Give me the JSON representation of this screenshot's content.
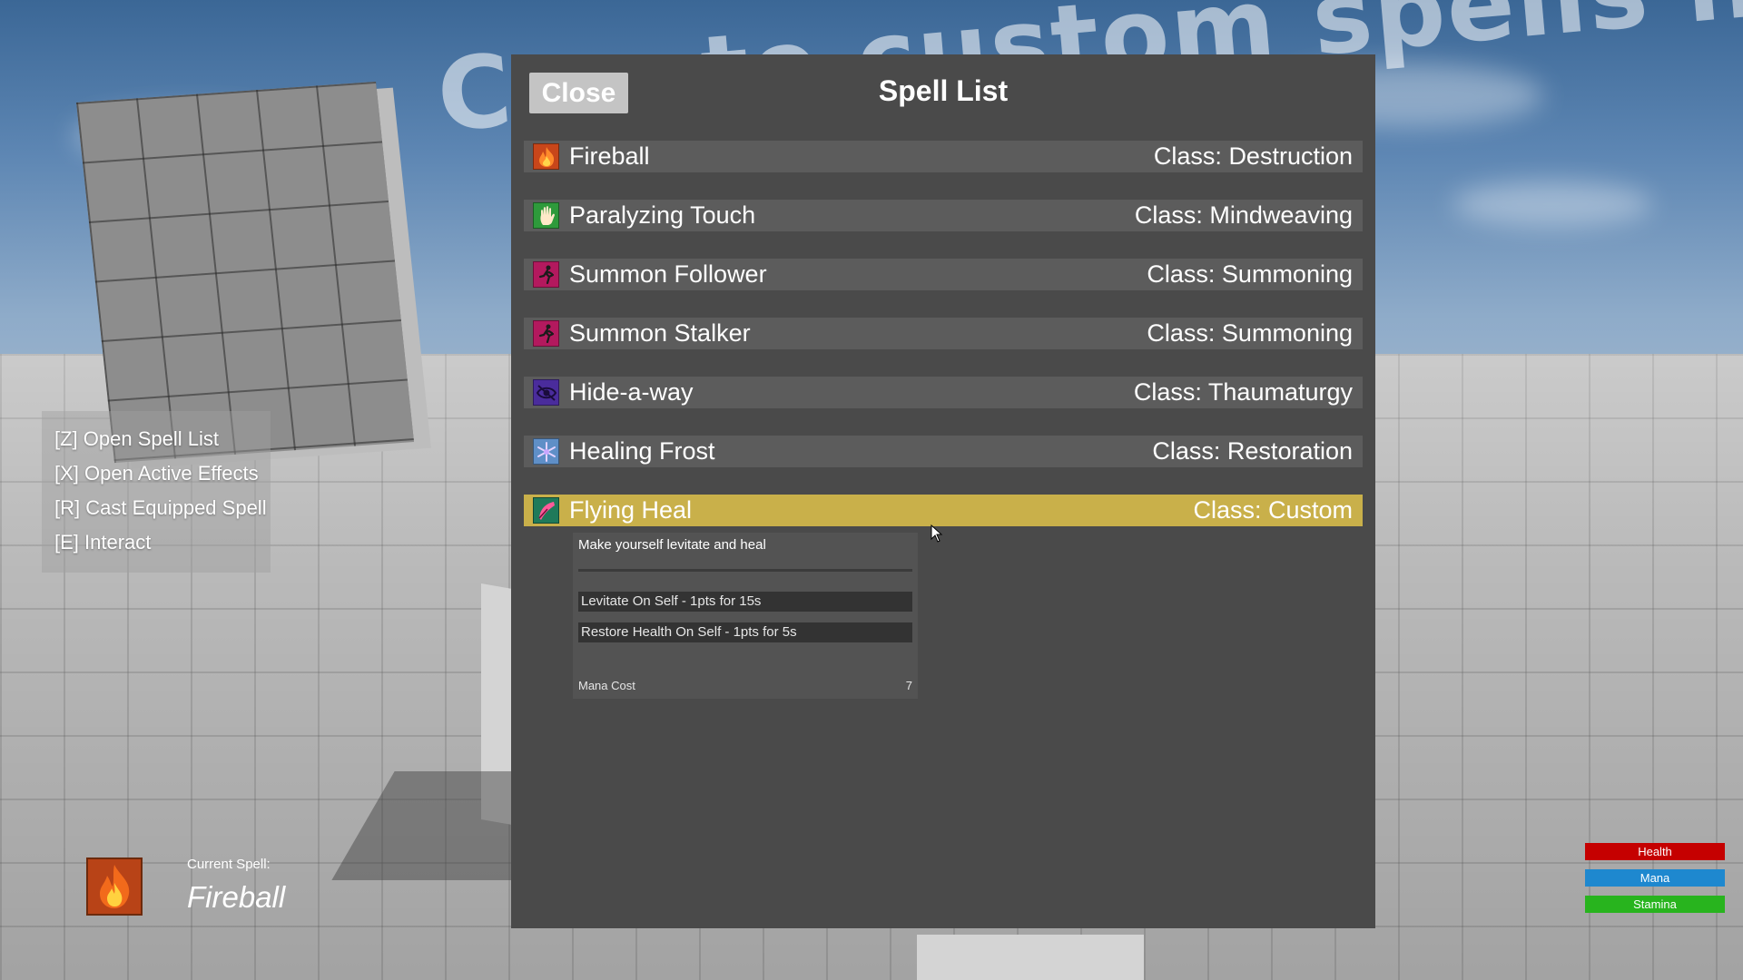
{
  "background": {
    "banner_text": "Create custom spells here"
  },
  "controls": {
    "items": [
      {
        "label": "[Z] Open Spell List"
      },
      {
        "label": "[X] Open Active Effects"
      },
      {
        "label": "[R] Cast Equipped Spell"
      },
      {
        "label": "[E] Interact"
      }
    ]
  },
  "current_spell": {
    "label": "Current Spell:",
    "name": "Fireball",
    "icon": "fire-icon"
  },
  "stats": [
    {
      "label": "Health",
      "color": "#c50000"
    },
    {
      "label": "Mana",
      "color": "#1e88cf"
    },
    {
      "label": "Stamina",
      "color": "#28b41e"
    }
  ],
  "panel": {
    "close_label": "Close",
    "title": "Spell List"
  },
  "spells": [
    {
      "name": "Fireball",
      "class": "Class: Destruction",
      "icon": "fire-icon",
      "icon_color": "#c8461a"
    },
    {
      "name": "Paralyzing Touch",
      "class": "Class: Mindweaving",
      "icon": "hand-icon",
      "icon_color": "#2e9a3b"
    },
    {
      "name": "Summon Follower",
      "class": "Class: Summoning",
      "icon": "running-figure-icon",
      "icon_color": "#b3195e"
    },
    {
      "name": "Summon Stalker",
      "class": "Class: Summoning",
      "icon": "running-figure-icon",
      "icon_color": "#b3195e"
    },
    {
      "name": "Hide-a-way",
      "class": "Class: Thaumaturgy",
      "icon": "eye-icon",
      "icon_color": "#4a2c9c"
    },
    {
      "name": "Healing Frost",
      "class": "Class: Restoration",
      "icon": "snowflake-icon",
      "icon_color": "#5f8fc7"
    },
    {
      "name": "Flying Heal",
      "class": "Class: Custom",
      "icon": "feather-icon",
      "icon_color": "#1f7a5a",
      "selected": true
    }
  ],
  "detail": {
    "description": "Make yourself levitate and heal",
    "effects": [
      {
        "text": "Levitate On Self - 1pts for 15s"
      },
      {
        "text": "Restore Health On Self - 1pts for 5s"
      }
    ],
    "mana_label": "Mana Cost",
    "mana_value": "7"
  },
  "colors": {
    "panel_bg": "#4a4a4a",
    "row_bg": "#5c5c5c",
    "selected_row": "#c9b04a"
  }
}
